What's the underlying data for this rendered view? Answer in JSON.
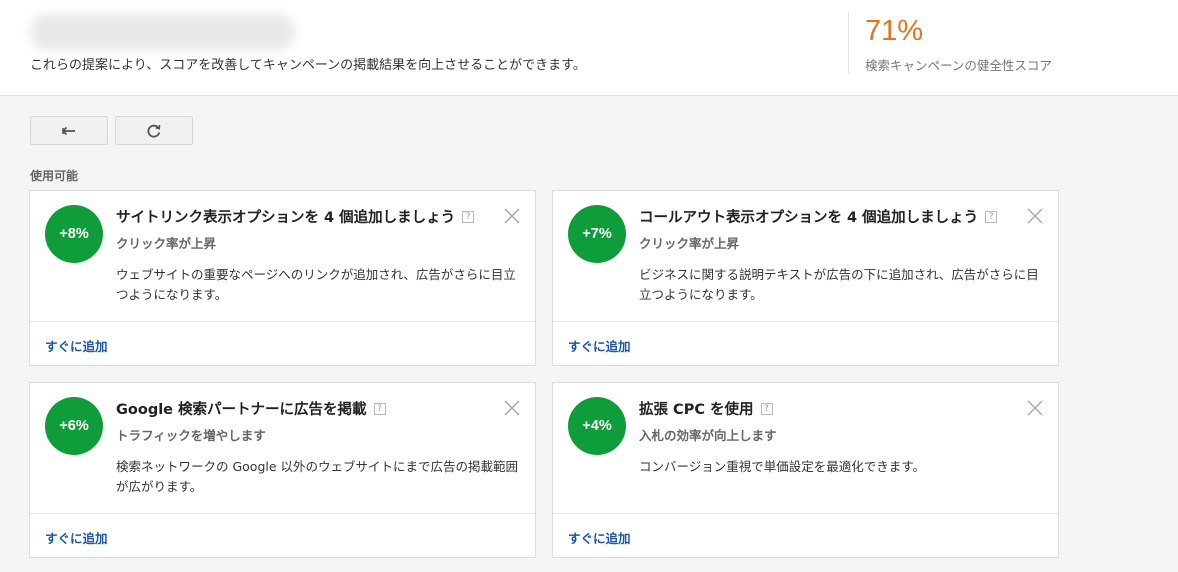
{
  "header": {
    "description": "これらの提案により、スコアを改善してキャンペーンの掲載結果を向上させることができます。",
    "score_value": "71%",
    "score_label": "検索キャンペーンの健全性スコア"
  },
  "toolbar": {
    "back_icon": "back-arrow-icon",
    "refresh_icon": "refresh-icon"
  },
  "section_label": "使用可能",
  "colors": {
    "score": "#e8731c",
    "badge": "#0f9d3c",
    "link": "#1a56a8"
  },
  "cards": [
    {
      "badge": "+8%",
      "title": "サイトリンク表示オプションを 4 個追加しましょう",
      "subtitle": "クリック率が上昇",
      "description": "ウェブサイトの重要なページへのリンクが追加され、広告がさらに目立つようになります。",
      "action": "すぐに追加"
    },
    {
      "badge": "+7%",
      "title": "コールアウト表示オプションを 4 個追加しましょう",
      "subtitle": "クリック率が上昇",
      "description": "ビジネスに関する説明テキストが広告の下に追加され、広告がさらに目立つようになります。",
      "action": "すぐに追加"
    },
    {
      "badge": "+6%",
      "title": "Google 検索パートナーに広告を掲載",
      "subtitle": "トラフィックを増やします",
      "description": "検索ネットワークの Google 以外のウェブサイトにまで広告の掲載範囲が広がります。",
      "action": "すぐに追加"
    },
    {
      "badge": "+4%",
      "title": "拡張 CPC を使用",
      "subtitle": "入札の効率が向上します",
      "description": "コンバージョン重視で単価設定を最適化できます。",
      "action": "すぐに追加"
    }
  ]
}
